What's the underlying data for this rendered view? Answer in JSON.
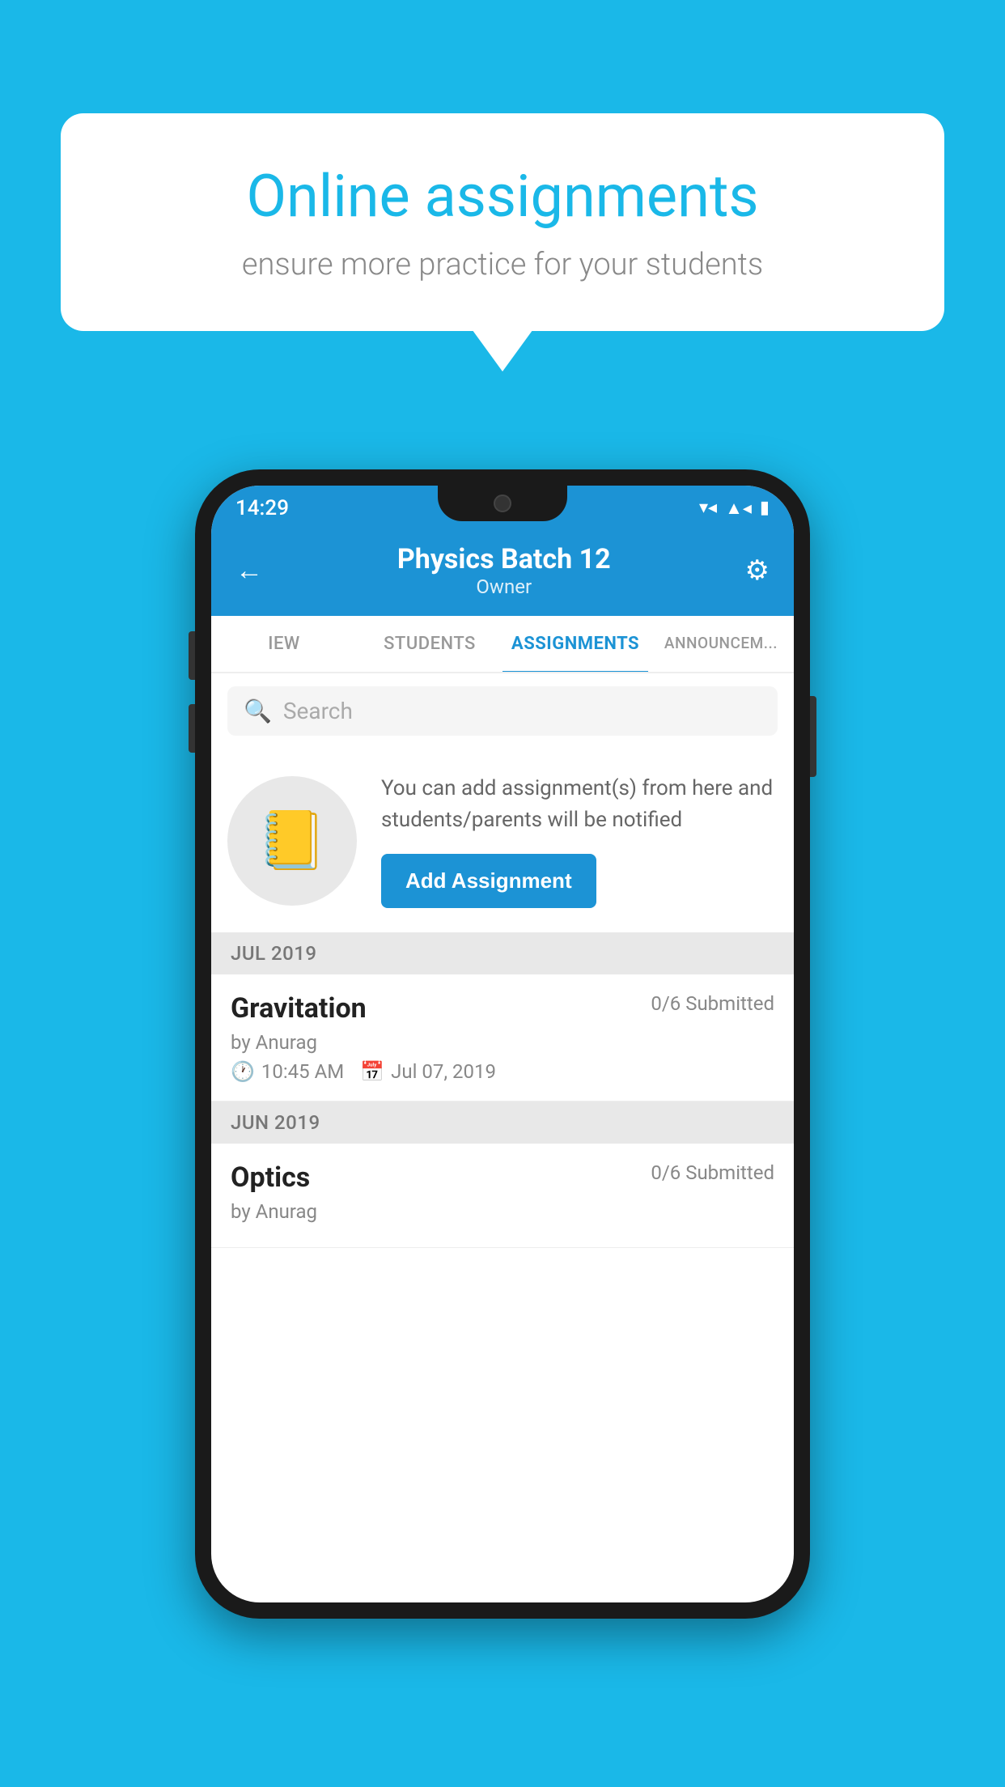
{
  "background_color": "#1ab8e8",
  "speech_bubble": {
    "title": "Online assignments",
    "subtitle": "ensure more practice for your students"
  },
  "phone": {
    "status_bar": {
      "time": "14:29",
      "icons": [
        "wifi",
        "signal",
        "battery"
      ]
    },
    "header": {
      "title": "Physics Batch 12",
      "subtitle": "Owner",
      "back_label": "←",
      "settings_label": "⚙"
    },
    "tabs": [
      {
        "label": "IEW",
        "active": false
      },
      {
        "label": "STUDENTS",
        "active": false
      },
      {
        "label": "ASSIGNMENTS",
        "active": true
      },
      {
        "label": "ANNOUNCEM...",
        "active": false
      }
    ],
    "search": {
      "placeholder": "Search"
    },
    "empty_state": {
      "description": "You can add assignment(s) from here and students/parents will be notified",
      "button_label": "Add Assignment"
    },
    "assignment_groups": [
      {
        "month": "JUL 2019",
        "assignments": [
          {
            "title": "Gravitation",
            "submitted": "0/6 Submitted",
            "author": "by Anurag",
            "time": "10:45 AM",
            "date": "Jul 07, 2019"
          }
        ]
      },
      {
        "month": "JUN 2019",
        "assignments": [
          {
            "title": "Optics",
            "submitted": "0/6 Submitted",
            "author": "by Anurag",
            "time": "",
            "date": ""
          }
        ]
      }
    ]
  }
}
